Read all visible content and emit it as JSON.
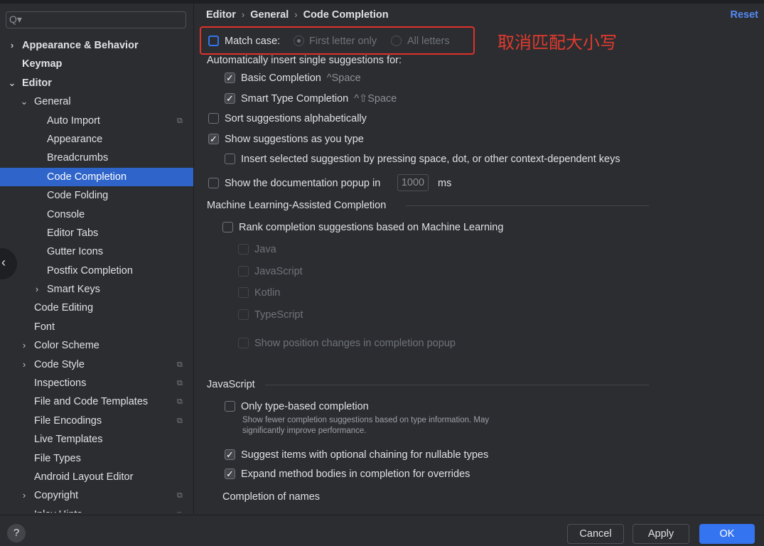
{
  "sidebar": {
    "search_placeholder": "",
    "items": [
      {
        "label": "Appearance & Behavior",
        "chevron": "›",
        "bold": true
      },
      {
        "label": "Keymap",
        "bold": true
      },
      {
        "label": "Editor",
        "chevron": "⌄",
        "bold": true
      },
      {
        "label": "General",
        "chevron": "⌄"
      },
      {
        "label": "Auto Import",
        "config": true
      },
      {
        "label": "Appearance"
      },
      {
        "label": "Breadcrumbs"
      },
      {
        "label": "Code Completion",
        "selected": true
      },
      {
        "label": "Code Folding"
      },
      {
        "label": "Console"
      },
      {
        "label": "Editor Tabs"
      },
      {
        "label": "Gutter Icons"
      },
      {
        "label": "Postfix Completion"
      },
      {
        "label": "Smart Keys",
        "chevron": "›"
      },
      {
        "label": "Code Editing"
      },
      {
        "label": "Font"
      },
      {
        "label": "Color Scheme",
        "chevron": "›"
      },
      {
        "label": "Code Style",
        "chevron": "›",
        "config": true
      },
      {
        "label": "Inspections",
        "config": true
      },
      {
        "label": "File and Code Templates",
        "config": true
      },
      {
        "label": "File Encodings",
        "config": true
      },
      {
        "label": "Live Templates"
      },
      {
        "label": "File Types"
      },
      {
        "label": "Android Layout Editor"
      },
      {
        "label": "Copyright",
        "chevron": "›",
        "config": true
      },
      {
        "label": "Inlay Hints",
        "chevron": "›",
        "config": true
      }
    ]
  },
  "breadcrumb": {
    "parts": [
      "Editor",
      "General",
      "Code Completion"
    ],
    "separator": "›"
  },
  "reset_label": "Reset",
  "match_case": {
    "label": "Match case:",
    "checked": false,
    "options": [
      "First letter only",
      "All letters"
    ],
    "selected_option": "First letter only"
  },
  "annotation": "取消匹配大小写",
  "auto_insert": {
    "heading": "Automatically insert single suggestions for:",
    "basic": {
      "label": "Basic Completion",
      "shortcut": "^Space",
      "checked": true
    },
    "smart": {
      "label": "Smart Type Completion",
      "shortcut": "^⇧Space",
      "checked": true
    }
  },
  "sort_alpha": {
    "label": "Sort suggestions alphabetically",
    "checked": false
  },
  "show_as_type": {
    "label": "Show suggestions as you type",
    "checked": true
  },
  "insert_by_space": {
    "label": "Insert selected suggestion by pressing space, dot, or other context-dependent keys",
    "checked": false
  },
  "doc_popup": {
    "label": "Show the documentation popup in",
    "value": "1000",
    "unit": "ms",
    "checked": false
  },
  "ml": {
    "heading": "Machine Learning-Assisted Completion",
    "rank": {
      "label": "Rank completion suggestions based on Machine Learning",
      "checked": false
    },
    "languages": [
      "Java",
      "JavaScript",
      "Kotlin",
      "TypeScript"
    ],
    "position_changes": "Show position changes in completion popup"
  },
  "javascript": {
    "heading": "JavaScript",
    "type_based": {
      "label": "Only type-based completion",
      "checked": false,
      "description_line1": "Show fewer completion suggestions based on type information. May",
      "description_line2": "significantly improve performance."
    },
    "optional_chaining": {
      "label": "Suggest items with optional chaining for nullable types",
      "checked": true
    },
    "expand_bodies": {
      "label": "Expand method bodies in completion for overrides",
      "checked": true
    },
    "names_heading": "Completion of names"
  },
  "footer": {
    "help": "?",
    "cancel": "Cancel",
    "apply": "Apply",
    "ok": "OK"
  },
  "icons": {
    "back": "‹",
    "search": "Q▾",
    "config": "⧉"
  },
  "colors": {
    "accent": "#3574f0",
    "selection": "#2f65ca",
    "annotation_red": "#e0312c",
    "link": "#548af7"
  }
}
